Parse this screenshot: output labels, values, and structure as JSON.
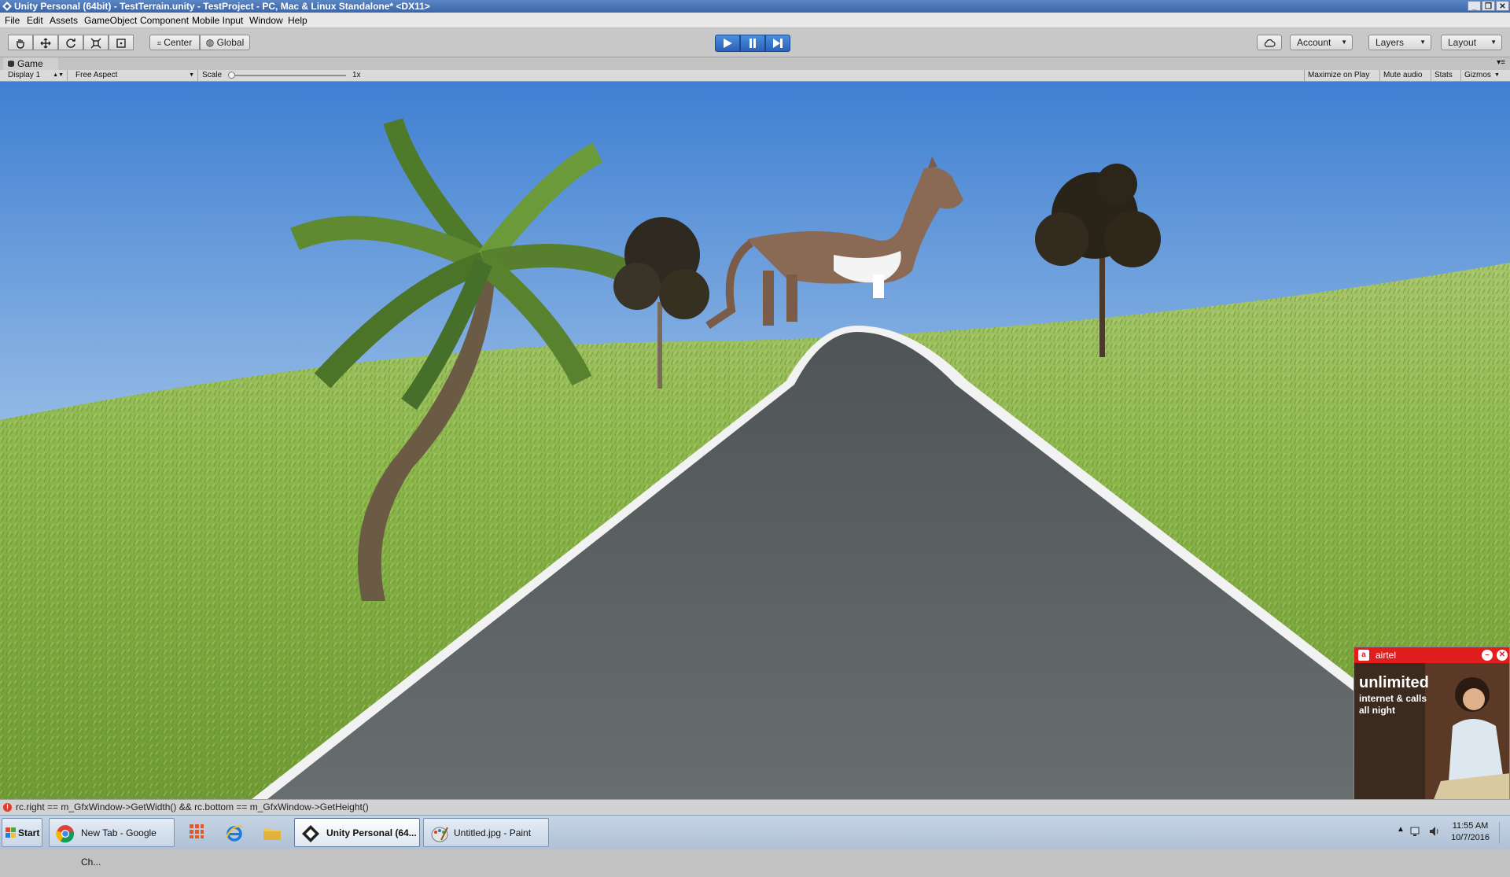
{
  "window": {
    "title": "Unity Personal (64bit) - TestTerrain.unity - TestProject - PC, Mac & Linux Standalone* <DX11>"
  },
  "menu": [
    "File",
    "Edit",
    "Assets",
    "GameObject",
    "Component",
    "Mobile Input",
    "Window",
    "Help"
  ],
  "toolbar": {
    "tools": [
      "hand-tool-icon",
      "move-tool-icon",
      "rotate-tool-icon",
      "scale-tool-icon",
      "rect-tool-icon"
    ],
    "pivot_label": "Center",
    "space_label": "Global",
    "account_label": "Account",
    "layers_label": "Layers",
    "layout_label": "Layout"
  },
  "game_view": {
    "tab_label": "Game",
    "display": "Display 1",
    "aspect": "Free Aspect",
    "scale_label": "Scale",
    "scale_value": "1x",
    "scale_fraction": 0.0,
    "maximize_on_play": "Maximize on Play",
    "mute_audio": "Mute audio",
    "stats": "Stats",
    "gizmos": "Gizmos"
  },
  "console": {
    "message": "rc.right == m_GfxWindow->GetWidth() && rc.bottom == m_GfxWindow->GetHeight()"
  },
  "taskbar": {
    "start": "Start",
    "items": [
      {
        "label": "New Tab - Google Ch...",
        "icon": "chrome-icon"
      },
      {
        "label": "Unity Personal (64...",
        "icon": "unity-icon",
        "active": true
      },
      {
        "label": "Untitled.jpg - Paint",
        "icon": "paint-icon"
      }
    ],
    "time": "11:55 AM",
    "date": "10/7/2016"
  },
  "ad": {
    "brand": "airtel",
    "headline": "unlimited",
    "line1": "internet & calls",
    "line2": "all night"
  },
  "colors": {
    "play_active": "#2a62b8",
    "sky_top": "#4a86d6",
    "grass": "#8ab64a",
    "road": "#5f6567",
    "ad_red": "#e01e1e"
  }
}
